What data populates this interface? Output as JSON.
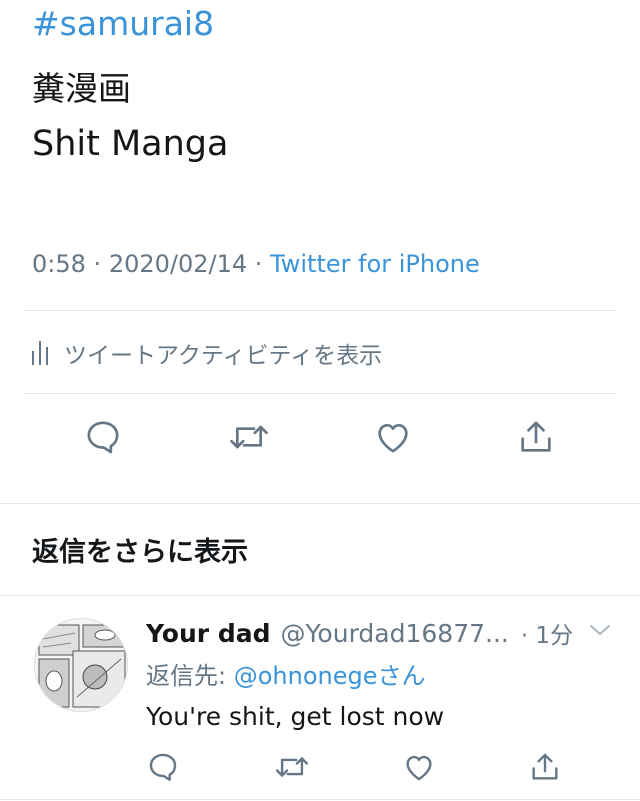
{
  "tweet": {
    "hashtag": "#samurai8",
    "line_jp": "糞漫画",
    "line_en": "Shit Manga",
    "time": "0:58",
    "date": "2020/02/14",
    "client": "Twitter for iPhone",
    "activity_label": "ツイートアクティビティを表示"
  },
  "more_replies_label": "返信をさらに表示",
  "reply": {
    "name": "Your dad",
    "handle": "@Yourdad16877...",
    "time": "· 1分",
    "reply_to_prefix": "返信先: ",
    "reply_to_mention": "@ohnonege",
    "reply_to_suffix": "さん",
    "text": "You're shit, get lost now"
  },
  "colors": {
    "link": "#3b94d9",
    "meta": "#657786",
    "text": "#14171a",
    "divider": "#e1e8ed"
  },
  "icons": [
    "reply-icon",
    "retweet-icon",
    "like-icon",
    "share-icon",
    "chevron-down-icon",
    "activity-bars-icon"
  ]
}
